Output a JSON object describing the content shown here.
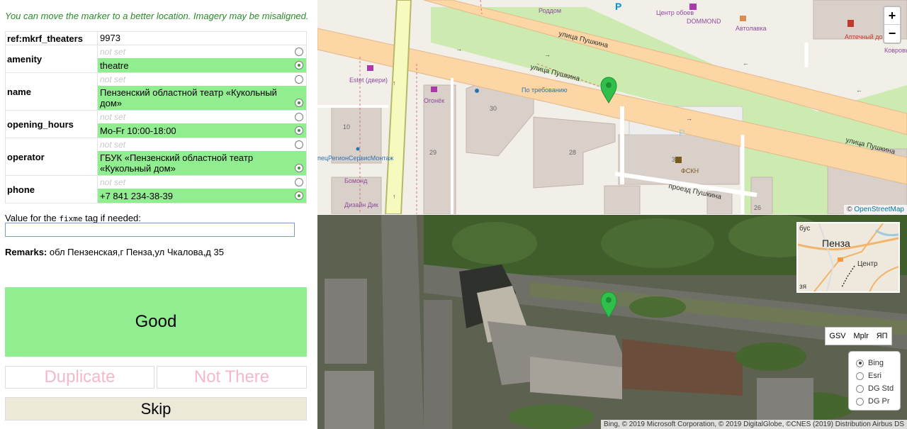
{
  "hint": "You can move the marker to a better location. Imagery may be misaligned.",
  "ref": {
    "key": "ref:mkrf_theaters",
    "value": "9973"
  },
  "tags": [
    {
      "key": "amenity",
      "notset": "not set",
      "value": "theatre"
    },
    {
      "key": "name",
      "notset": "not set",
      "value": "Пензенский областной театр «Кукольный дом»"
    },
    {
      "key": "opening_hours",
      "notset": "not set",
      "value": "Mo-Fr 10:00-18:00"
    },
    {
      "key": "operator",
      "notset": "not set",
      "value": "ГБУК «Пензенский областной театр «Кукольный дом»"
    },
    {
      "key": "phone",
      "notset": "not set",
      "value": "+7 841 234-38-39"
    }
  ],
  "fixme": {
    "label_pre": "Value for the ",
    "label_code": "fixme",
    "label_post": " tag if needed:",
    "value": ""
  },
  "remarks": {
    "label": "Remarks:",
    "text": "обл Пензенская,г Пенза,ул Чкалова,д 35"
  },
  "buttons": {
    "good": "Good",
    "duplicate": "Duplicate",
    "not_there": "Not There",
    "skip": "Skip"
  },
  "map_top": {
    "zoom_in": "+",
    "zoom_out": "−",
    "attribution_sym": "©",
    "attribution_link": "OpenStreetMap",
    "labels": {
      "street1": "улица Пушкина",
      "street2": "улица Пушкина",
      "street3": "улица Пушкина",
      "street4": "улица Пушкина",
      "lane": "проезд Пушкина",
      "roddom": "Роддом",
      "centr_oboev": "Центр обоев",
      "dommond": "DOMMOND",
      "avtolavka": "Автолавка",
      "aptechny": "Аптечный дом",
      "kovrovy": "Ковровый мир",
      "estet": "Estet (двери)",
      "po_trebovaniyu": "По требованию",
      "ogonek": "Огонёк",
      "fskn": "ФСКН",
      "regionservis": "пецРегионСервисМонтаж",
      "bomond": "Бомонд",
      "dizain": "Дизайн Дик",
      "n30a": "30",
      "n30b": "30",
      "n10": "10",
      "n29": "29",
      "n28": "28",
      "n26": "26"
    },
    "colors": {
      "road": "#f7fabf",
      "road_border": "#b8b86a",
      "street": "#fcd6a4",
      "park": "#cdebb0",
      "building": "#d9d0c9"
    }
  },
  "map_bottom": {
    "providers": [
      "GSV",
      "Mplr",
      "ЯП"
    ],
    "layers": [
      {
        "label": "Bing",
        "selected": true
      },
      {
        "label": "Esri",
        "selected": false
      },
      {
        "label": "DG Std",
        "selected": false
      },
      {
        "label": "DG Pr",
        "selected": false
      }
    ],
    "minimap": {
      "city": "Пенза",
      "center": "Центр",
      "top_left": "бус",
      "bottom_left": "зя"
    },
    "attribution": "Bing, © 2019 Microsoft Corporation, © 2019 DigitalGlobe, ©CNES (2019) Distribution Airbus DS"
  },
  "marker_color": "#2fbf4a"
}
